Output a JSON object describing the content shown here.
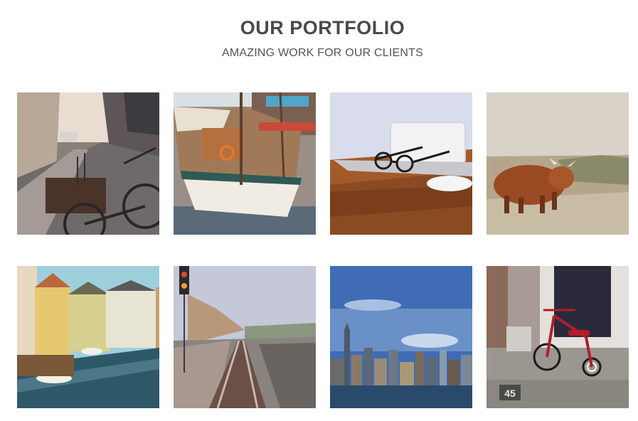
{
  "header": {
    "title": "OUR PORTFOLIO",
    "subtitle": "AMAZING WORK FOR OUR CLIENTS"
  },
  "portfolio": {
    "items": [
      {
        "subject": "bicycle on street"
      },
      {
        "subject": "sailing boat"
      },
      {
        "subject": "laptop and glasses"
      },
      {
        "subject": "highland cow"
      },
      {
        "subject": "canal houses"
      },
      {
        "subject": "railway tracks"
      },
      {
        "subject": "city skyline"
      },
      {
        "subject": "red tricycle",
        "sign_text": "45"
      }
    ]
  }
}
